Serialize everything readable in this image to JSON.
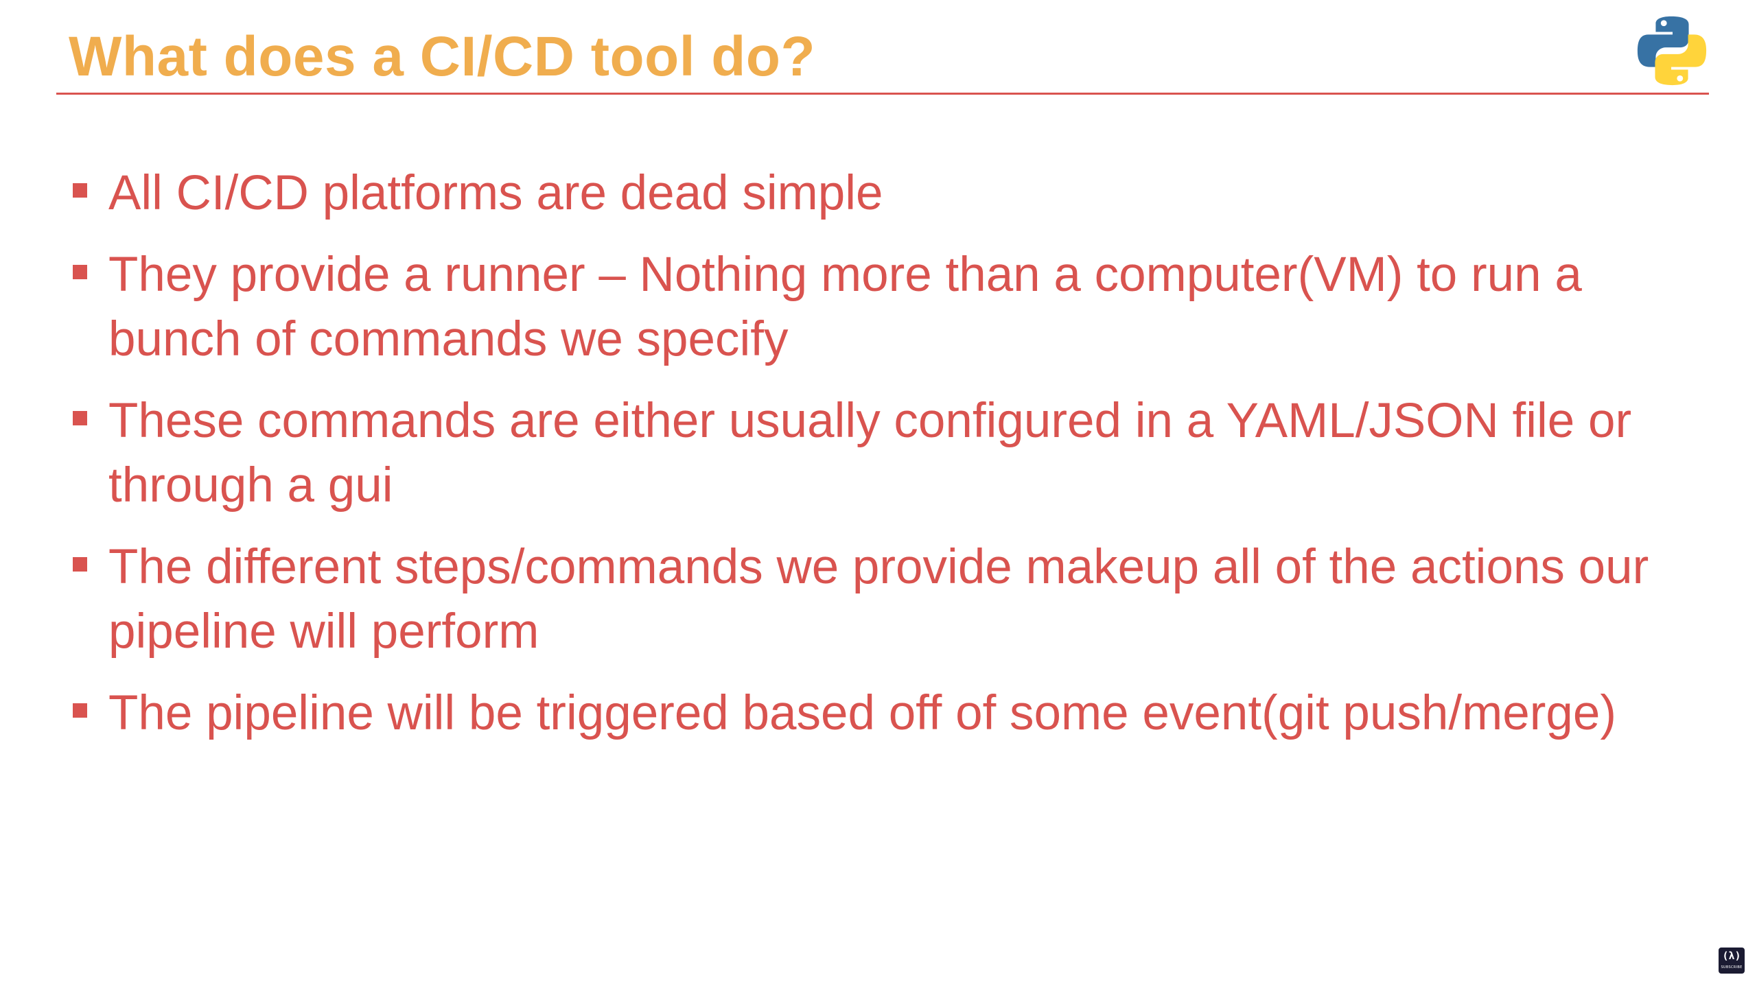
{
  "slide": {
    "title": "What does a CI/CD tool do?",
    "logo_icon": "python-logo-icon",
    "bullets": [
      "All CI/CD platforms are dead simple",
      "They provide a runner – Nothing more than a computer(VM) to run a bunch of commands we specify",
      "These commands are either usually configured in a YAML/JSON file or through a gui",
      "The different steps/commands we provide makeup all of the actions our pipeline will perform",
      "The pipeline will be triggered based off of some event(git push/merge)"
    ]
  },
  "badge": {
    "icon": "freecodecamp-icon",
    "glyph": "(λ)",
    "label": "SUBSCRIBE"
  },
  "colors": {
    "title": "#f0ad4e",
    "accent": "#d9534f",
    "background": "#ffffff",
    "python_blue": "#3772a4",
    "python_yellow": "#ffd43b"
  }
}
